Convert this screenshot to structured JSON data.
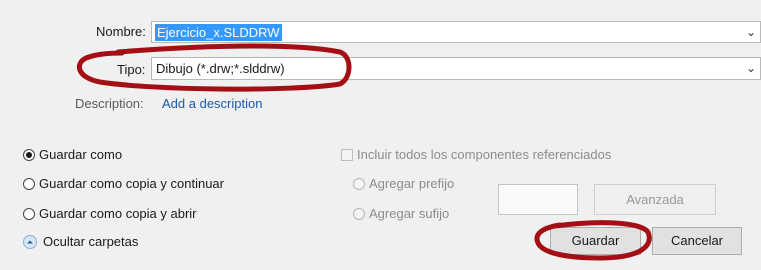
{
  "fields": {
    "nombre_label": "Nombre:",
    "nombre_value": "Ejercicio_x.SLDDRW",
    "tipo_label": "Tipo:",
    "tipo_value": "Dibujo (*.drw;*.slddrw)",
    "description_label": "Description:",
    "description_link": "Add a description"
  },
  "options": {
    "save_as": "Guardar como",
    "save_copy_continue": "Guardar como copia y continuar",
    "save_copy_open": "Guardar como copia y abrir",
    "selected": "save_as"
  },
  "references": {
    "include_all": "Incluir todos los componentes referenciados",
    "add_prefix": "Agregar prefijo",
    "add_suffix": "Agregar sufijo",
    "advanced": "Avanzada"
  },
  "footer": {
    "hide_folders": "Ocultar carpetas",
    "save_button": "Guardar",
    "cancel_button": "Cancelar"
  },
  "colors": {
    "annotation": "#a30f15",
    "selection": "#3399ff",
    "link": "#1a5aa8"
  }
}
